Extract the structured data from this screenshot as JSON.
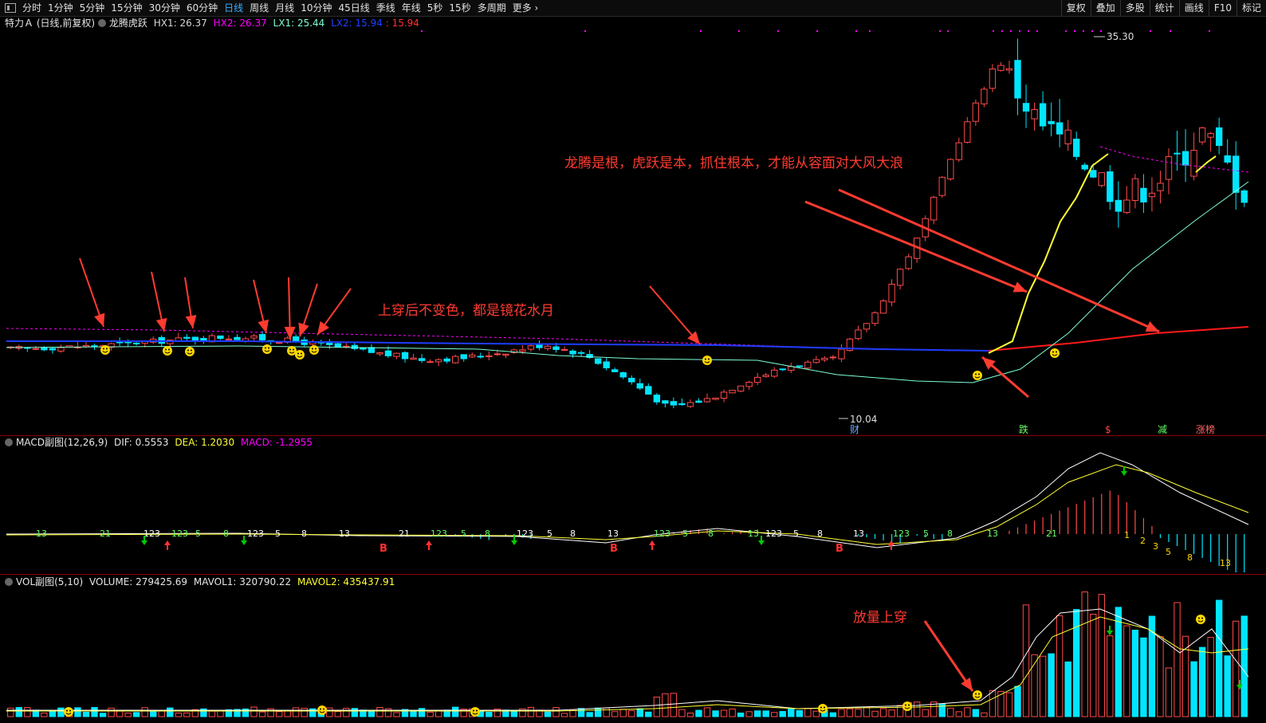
{
  "toolbar": {
    "periods": [
      "分时",
      "1分钟",
      "5分钟",
      "15分钟",
      "30分钟",
      "60分钟",
      "日线",
      "周线",
      "月线",
      "10分钟",
      "45日线",
      "季线",
      "年线",
      "5秒",
      "15秒",
      "多周期",
      "更多"
    ],
    "active_period": "日线",
    "right_buttons": [
      "复权",
      "叠加",
      "多股",
      "统计",
      "画线",
      "F10",
      "标记"
    ]
  },
  "main_panel": {
    "stock_name": "特力Ａ",
    "period_info": "(日线,前复权)",
    "indicator_name": "龙腾虎跃",
    "hx1": "HX1: 26.37",
    "hx2": "HX2: 26.37",
    "lx1": "LX1: 25.44",
    "lx2": "LX2: 15.94",
    "val5": ": 15.94",
    "high_label": "35.30",
    "low_label": "10.04",
    "event_labels": [
      "财",
      "跌",
      "$",
      "减",
      "涨榜"
    ],
    "annotation_top": "龙腾是根，虎跃是本，抓住根本，才能从容面对大风大浪",
    "annotation_mid": "上穿后不变色，都是镜花水月"
  },
  "macd_panel": {
    "title": "MACD副图(12,26,9)",
    "dif": "DIF: 0.5553",
    "dea": "DEA: 1.2030",
    "macd": "MACD: -1.2955"
  },
  "vol_panel": {
    "title": "VOL副图(5,10)",
    "volume": "VOLUME: 279425.69",
    "mavol1": "MAVOL1: 320790.22",
    "mavol2": "MAVOL2: 435437.91",
    "annotation": "放量上穿"
  },
  "colors": {
    "up": "#ff4a4a",
    "down": "#00e5ff",
    "hx2": "#ff00ff",
    "lx1": "#7fffd4",
    "lx2": "#1f3cff",
    "yellow": "#ffff33",
    "red_line": "#ff1a1a",
    "arrow": "#ff3b30"
  },
  "chart_data": {
    "type": "candlestick",
    "title": "特力Ａ 日线",
    "price_extremes": {
      "high": 35.3,
      "low": 10.04
    },
    "approx_close_path": [
      14.5,
      14.6,
      14.7,
      14.9,
      15.1,
      15.3,
      15.2,
      15.0,
      14.6,
      14.2,
      13.8,
      13.9,
      14.3,
      14.8,
      14.1,
      12.5,
      10.6,
      11.2,
      12.5,
      13.4,
      13.8,
      16.8,
      21.5,
      28.0,
      33.8,
      29.5,
      27.5,
      24.5,
      26.0,
      29.0,
      25.0
    ],
    "indicators": {
      "HX1": 26.37,
      "HX2": 26.37,
      "LX1": 25.44,
      "LX2": 15.94
    },
    "macd": {
      "DIF": 0.5553,
      "DEA": 1.203,
      "MACD": -1.2955
    },
    "vol": {
      "VOLUME": 279425.69,
      "MAVOL1": 320790.22,
      "MAVOL2": 435437.91
    }
  }
}
